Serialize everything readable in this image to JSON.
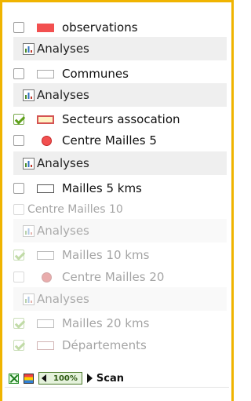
{
  "colors": {
    "frame": "#f0b400",
    "disabled_check": "#5fa11b"
  },
  "layers": [
    {
      "id": "observations",
      "label": "observations",
      "checked": false,
      "disabled": false,
      "symbol": "rect",
      "fill": "#f25050",
      "stroke": "#f25050"
    },
    {
      "id": "communes",
      "label": "Communes",
      "checked": false,
      "disabled": false,
      "symbol": "rect",
      "fill": "#ffffff",
      "stroke": "#aaaaaa"
    },
    {
      "id": "secteurs",
      "label": "Secteurs assocation",
      "checked": true,
      "disabled": false,
      "symbol": "rect",
      "fill": "#fff3c4",
      "stroke": "#d45353"
    },
    {
      "id": "centre5",
      "label": "Centre Mailles 5",
      "checked": false,
      "disabled": false,
      "symbol": "circle",
      "fill": "#f25050",
      "stroke": "#c62828"
    },
    {
      "id": "mailles5",
      "label": "Mailles 5 kms",
      "checked": false,
      "disabled": false,
      "symbol": "rect",
      "fill": "#ffffff",
      "stroke": "#555555"
    },
    {
      "id": "centre10",
      "label": "Centre Mailles 10",
      "checked": false,
      "disabled": true,
      "symbol": "none"
    },
    {
      "id": "mailles10",
      "label": "Mailles 10 kms",
      "checked": true,
      "disabled": true,
      "symbol": "rect",
      "fill": "#ffffff",
      "stroke": "#555555"
    },
    {
      "id": "centre20",
      "label": "Centre Mailles 20",
      "checked": false,
      "disabled": true,
      "symbol": "circle",
      "fill": "#c62828",
      "stroke": "#8b1a1a"
    },
    {
      "id": "mailles20",
      "label": "Mailles 20 kms",
      "checked": true,
      "disabled": true,
      "symbol": "rect",
      "fill": "#ffffff",
      "stroke": "#555555"
    },
    {
      "id": "departements",
      "label": "Départements",
      "checked": true,
      "disabled": true,
      "symbol": "rect",
      "fill": "#ffffff",
      "stroke": "#8b4040"
    }
  ],
  "analyses_label": "Analyses",
  "footer": {
    "zoom": "100%",
    "scan_label": "Scan"
  }
}
